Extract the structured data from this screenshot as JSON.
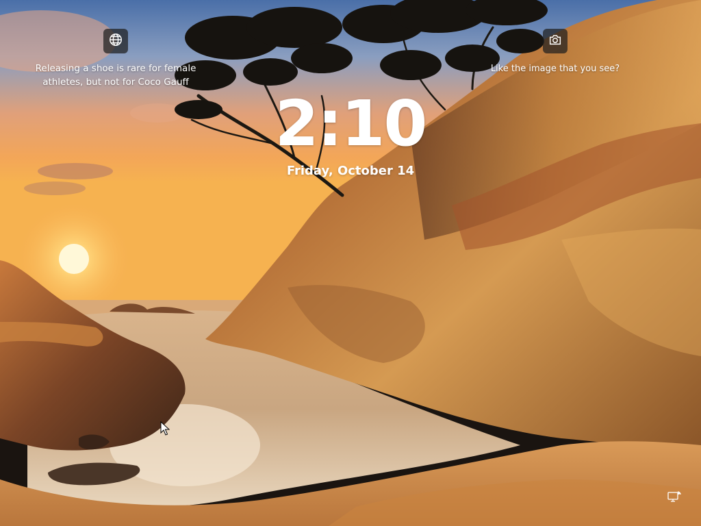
{
  "lockscreen": {
    "spotlight": {
      "icon": "globe-icon",
      "caption": "Releasing a shoe is rare for female athletes, but not for Coco Gauff"
    },
    "like_image": {
      "icon": "camera-icon",
      "caption": "Like the image that you see?"
    },
    "clock": {
      "time": "2:10",
      "date": "Friday, October 14"
    },
    "status": {
      "network_icon": "network-status-icon"
    }
  },
  "colors": {
    "widget_button_bg": "#1e1e1e",
    "text": "#ffffff"
  }
}
